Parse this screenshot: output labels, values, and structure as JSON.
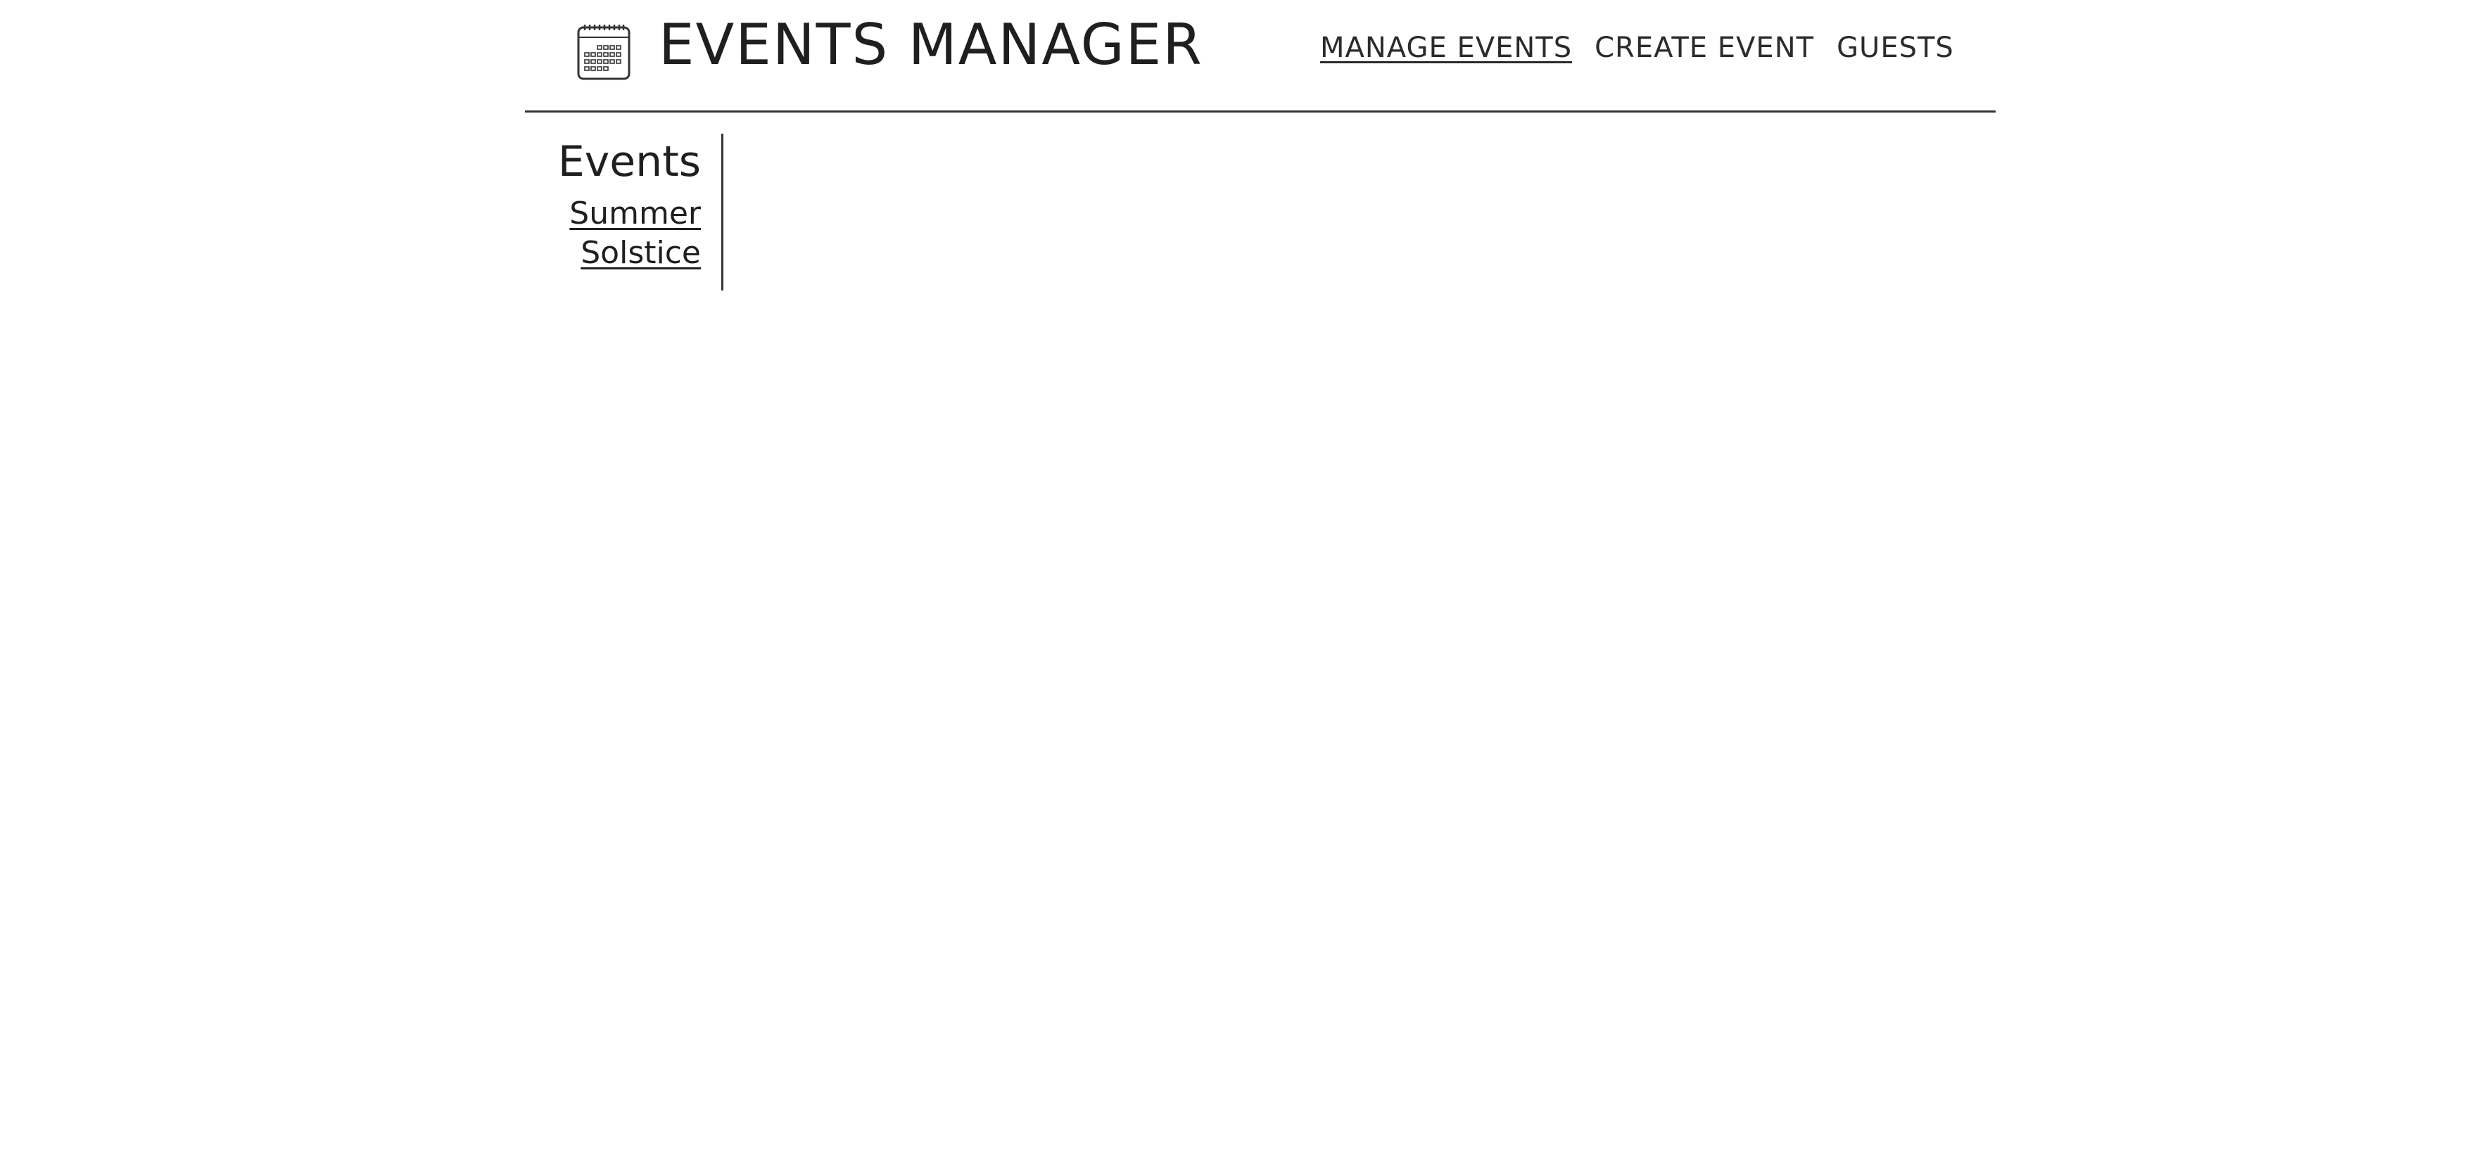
{
  "header": {
    "logo_icon": "calendar-icon",
    "app_title": "EVENTS MANAGER",
    "nav": [
      {
        "label": "MANAGE EVENTS",
        "active": true
      },
      {
        "label": "CREATE EVENT",
        "active": false
      },
      {
        "label": "GUESTS",
        "active": false
      }
    ]
  },
  "sidebar": {
    "title": "Events",
    "events": [
      {
        "label": "Summer Solstice"
      }
    ]
  },
  "colors": {
    "text": "#1f1f1f",
    "divider": "#333333",
    "background": "#ffffff"
  }
}
